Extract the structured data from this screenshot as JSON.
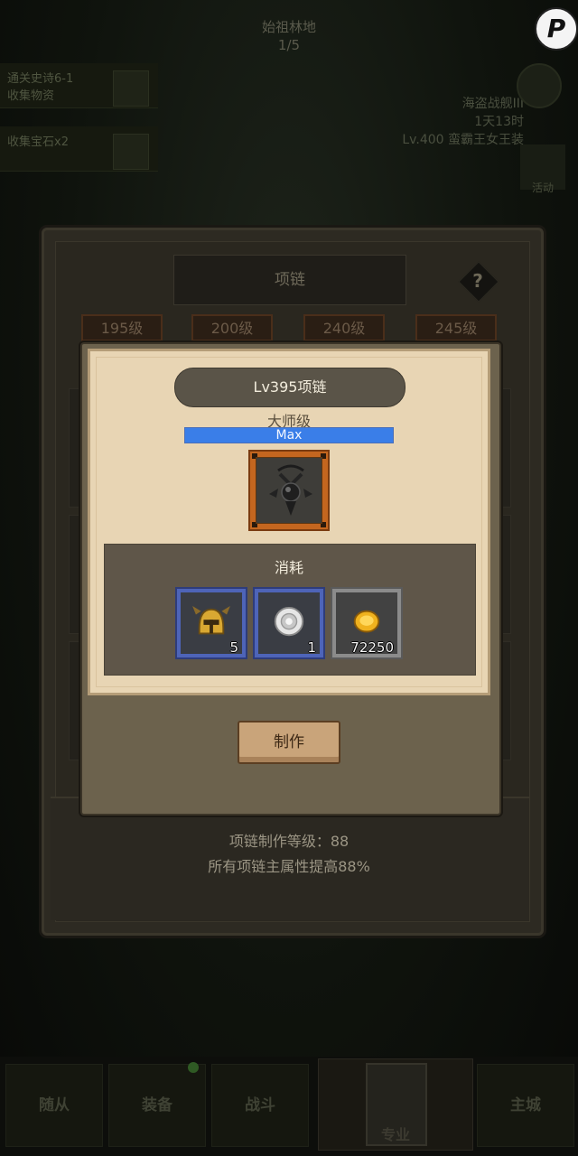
{
  "background": {
    "map_title": "始祖林地",
    "map_progress": "1/5",
    "quest_1": "通关史诗6-1\n收集物资",
    "quest_2": "收集宝石x2",
    "info_lines": [
      "海盗战舰III",
      "1天13时",
      "Lv.400 蛮霸王女王装"
    ],
    "event_label": "活动",
    "logo_letter": "P"
  },
  "back_panel": {
    "header": "项链",
    "help_symbol": "?",
    "tier_tabs": [
      "195级",
      "200级",
      "240级",
      "245级"
    ],
    "footer_line_1": "项链制作等级：88",
    "footer_line_2": "所有项链主属性提高88%"
  },
  "dialog": {
    "title": "Lv395项链",
    "grade": "大师级",
    "progress_label": "Max",
    "progress": 1.0,
    "item_icon": "necklace-icon",
    "consume_title": "消耗",
    "costs": [
      {
        "icon": "helmet-icon",
        "count": "5",
        "rarity": "blue"
      },
      {
        "icon": "silver-ore-icon",
        "count": "1",
        "rarity": "blue"
      },
      {
        "icon": "gold-coin-icon",
        "count": "72250",
        "rarity": "gray"
      }
    ],
    "craft_label": "制作"
  },
  "bottom_nav": {
    "items": [
      "随从",
      "装备",
      "战斗",
      "专业",
      "主城"
    ]
  },
  "colors": {
    "progress_bar": "#3a7ee8",
    "item_frame": "#c4661f",
    "cost_slot_blue": "#4e64b8",
    "card_bg": "#e8d5b4"
  }
}
